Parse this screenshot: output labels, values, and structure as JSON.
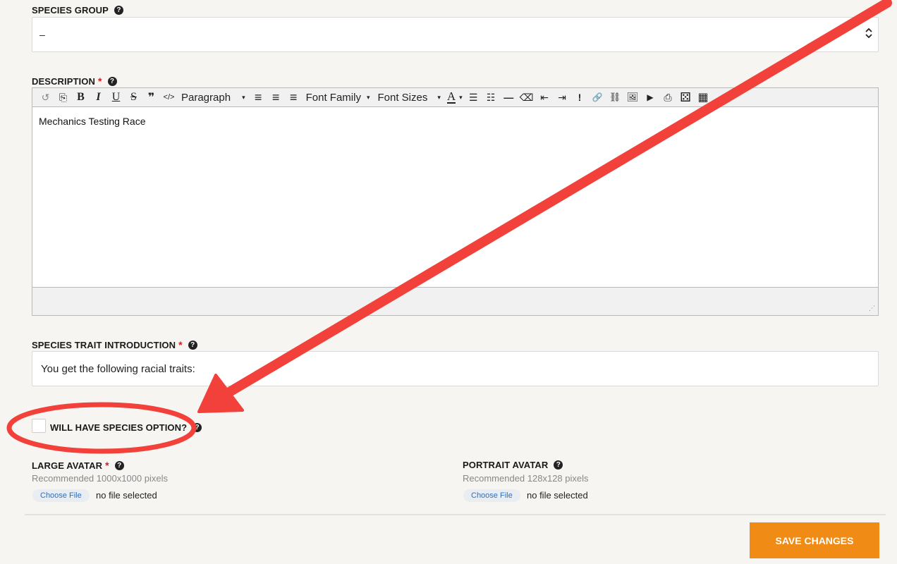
{
  "species_group": {
    "label": "SPECIES GROUP",
    "help": "?",
    "value": "–",
    "chevron": "⌃⌄"
  },
  "description": {
    "label": "DESCRIPTION",
    "required": "*",
    "help": "?",
    "toolbar": {
      "paragraph": "Paragraph",
      "font_family": "Font Family",
      "font_sizes": "Font Sizes",
      "undo": "↺",
      "paste": "⎘",
      "bold": "B",
      "italic": "I",
      "underline": "U",
      "strike": "S",
      "quote": "❞",
      "code": "</>",
      "align_left": "≡",
      "align_center": "≡",
      "align_right": "≡",
      "font_color": "A",
      "bullet_list": "☰",
      "num_list": "☷",
      "hr": "—",
      "eraser": "⌫",
      "outdent": "⇤",
      "indent": "⇥",
      "exclaim": "!",
      "link": "🔗",
      "unlink": "⛓",
      "image": "🖼",
      "video": "▶",
      "doc": "⎙",
      "dice": "⚄",
      "table": "▦",
      "caret": "▾"
    },
    "content": "Mechanics Testing Race",
    "grip": "⋰"
  },
  "trait_intro": {
    "label": "SPECIES TRAIT INTRODUCTION",
    "required": "*",
    "help": "?",
    "value": "You get the following racial traits:"
  },
  "species_option": {
    "label": "WILL HAVE SPECIES OPTION?",
    "help": "?"
  },
  "large_avatar": {
    "label": "LARGE AVATAR",
    "required": "*",
    "help": "?",
    "hint": "Recommended 1000x1000 pixels",
    "button": "Choose File",
    "status": "no file selected"
  },
  "portrait_avatar": {
    "label": "PORTRAIT AVATAR",
    "help": "?",
    "hint": "Recommended 128x128 pixels",
    "button": "Choose File",
    "status": "no file selected"
  },
  "save_button": "SAVE CHANGES",
  "colors": {
    "accent": "#f08c16",
    "annotation": "#f2403b",
    "required": "#d21c1c"
  }
}
